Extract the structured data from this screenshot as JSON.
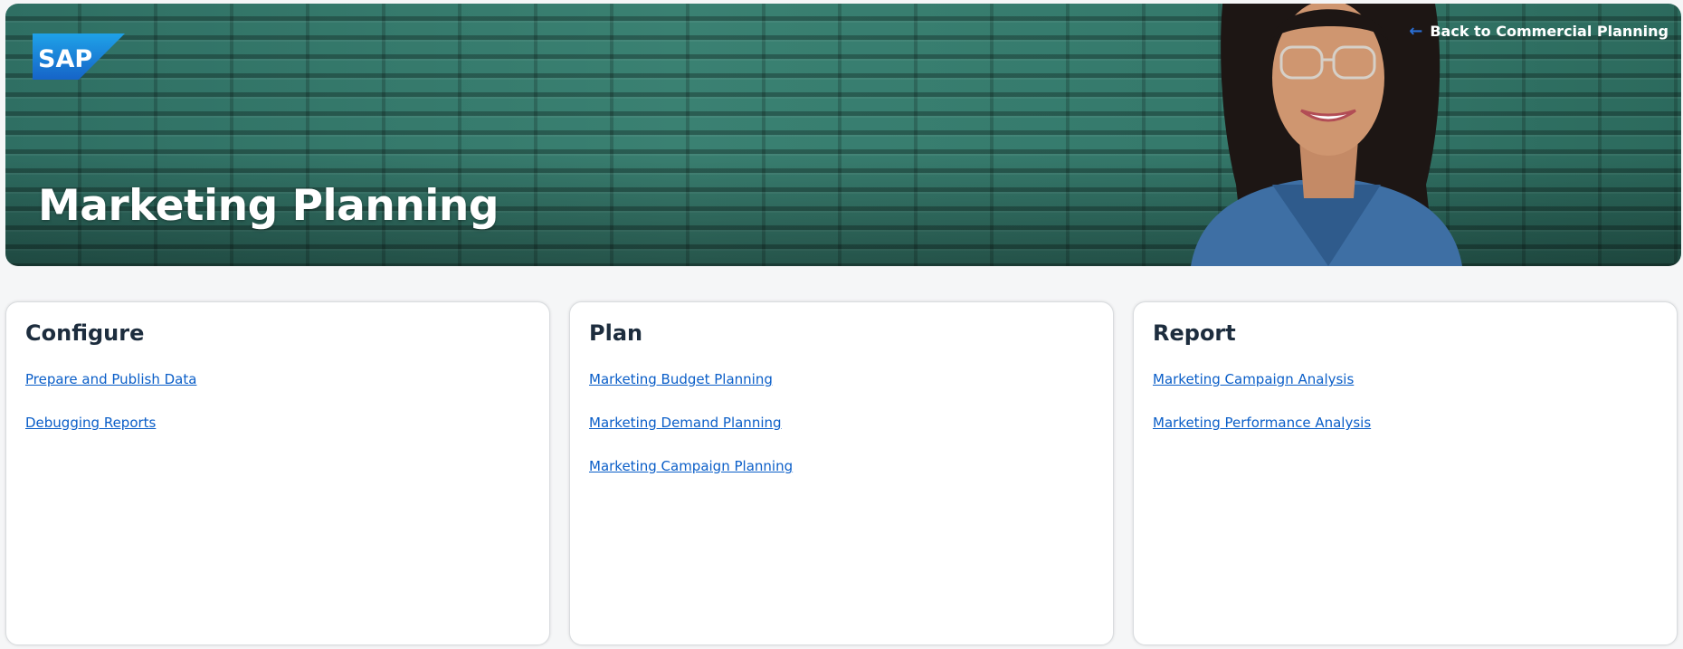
{
  "banner": {
    "logo_text": "SAP",
    "title": "Marketing Planning",
    "back_link": "Back to Commercial Planning"
  },
  "cards": [
    {
      "title": "Configure",
      "links": [
        "Prepare and Publish Data",
        "Debugging Reports"
      ]
    },
    {
      "title": "Plan",
      "links": [
        "Marketing Budget Planning",
        "Marketing Demand Planning",
        "Marketing Campaign Planning"
      ]
    },
    {
      "title": "Report",
      "links": [
        "Marketing Campaign Analysis",
        "Marketing Performance Analysis"
      ]
    }
  ],
  "colors": {
    "banner_green": "#357a6c",
    "link_blue": "#0a5ec8",
    "heading": "#1d2d3e",
    "sap_blue": "#1a73d9"
  }
}
